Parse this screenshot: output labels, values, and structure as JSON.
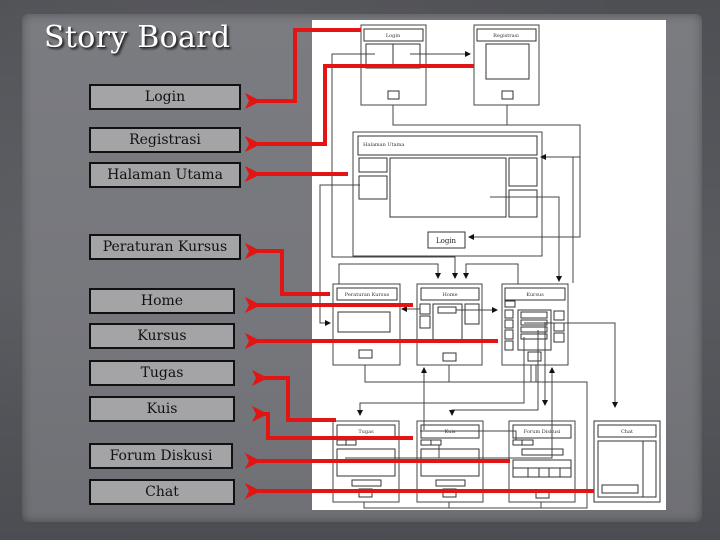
{
  "title": "Story Board",
  "labels": [
    {
      "id": "login",
      "text": "Login"
    },
    {
      "id": "registrasi",
      "text": "Registrasi"
    },
    {
      "id": "halaman-utama",
      "text": "Halaman Utama"
    },
    {
      "id": "peraturan-kursus",
      "text": "Peraturan Kursus"
    },
    {
      "id": "home",
      "text": "Home"
    },
    {
      "id": "kursus",
      "text": "Kursus"
    },
    {
      "id": "tugas",
      "text": "Tugas"
    },
    {
      "id": "kuis",
      "text": "Kuis"
    },
    {
      "id": "forum-diskusi",
      "text": "Forum Diskusi"
    },
    {
      "id": "chat",
      "text": "Chat"
    }
  ],
  "wireframes": {
    "login": {
      "header": "Login"
    },
    "registrasi": {
      "header": "Registrasi"
    },
    "halaman_utama": {
      "header": "Halaman Utama",
      "login_button": "Login"
    },
    "peraturan_kursus": {
      "header": "Peraturan Kursus"
    },
    "home": {
      "header": "Home"
    },
    "kursus": {
      "header": "Kursus"
    },
    "tugas": {
      "header": "Tugas"
    },
    "kuis": {
      "header": "Kuis"
    },
    "forum_diskusi": {
      "header": "Forum Diskusi"
    },
    "chat": {
      "header": "Chat"
    }
  },
  "colors": {
    "arrow": "#e31414",
    "label_bg": "#a4a4a6",
    "diagram_bg": "#ffffff"
  }
}
